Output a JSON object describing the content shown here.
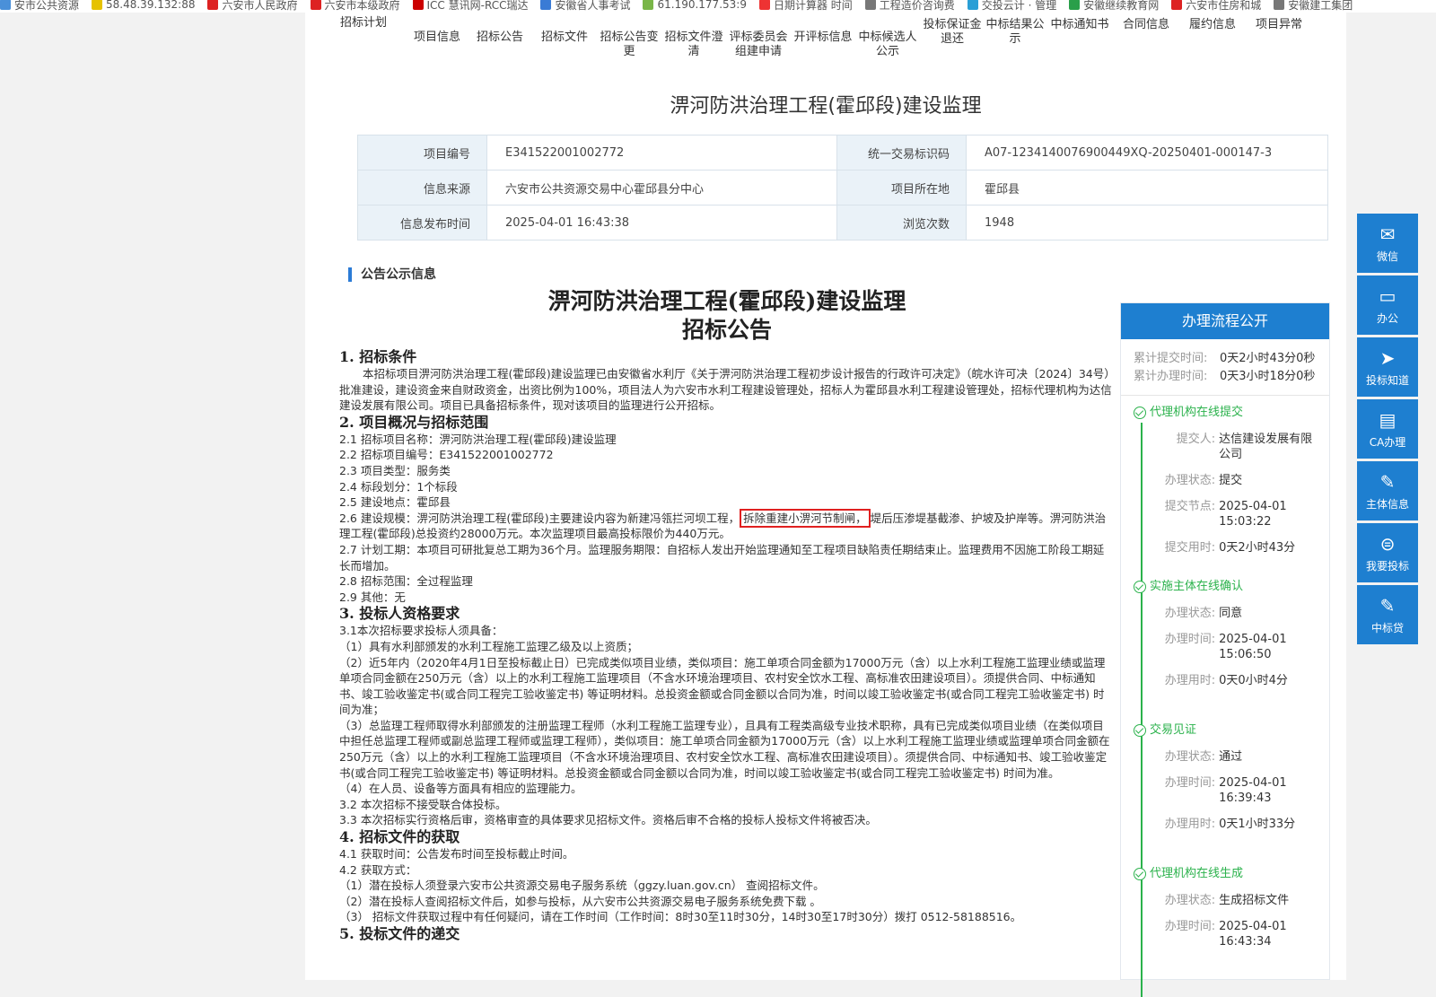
{
  "bookmarks": [
    {
      "label": "安市公共资源",
      "color": "#4a90d9"
    },
    {
      "label": "58.48.39.132:88",
      "color": "#e6c200"
    },
    {
      "label": "六安市人民政府",
      "color": "#d22"
    },
    {
      "label": "六安市本级政府",
      "color": "#d22"
    },
    {
      "label": "ICC 慧讯网-RCC瑞达",
      "color": "#c00"
    },
    {
      "label": "安徽省人事考试",
      "color": "#3a7bd5"
    },
    {
      "label": "61.190.177.53:9",
      "color": "#7ab648"
    },
    {
      "label": "日期计算器 时间",
      "color": "#e33"
    },
    {
      "label": "工程造价咨询费",
      "color": "#777"
    },
    {
      "label": "交投云计 · 管理",
      "color": "#2a9fd6"
    },
    {
      "label": "安徽继续教育网",
      "color": "#2a9f4a"
    },
    {
      "label": "六安市住房和城",
      "color": "#d22"
    },
    {
      "label": "安徽建工集团",
      "color": "#777"
    }
  ],
  "tabs_top": [
    "招标计划",
    "投标保证金退还",
    "中标结果公示",
    "中标通知书",
    "合同信息",
    "履约信息",
    "项目异常"
  ],
  "tabs": [
    "项目信息",
    "招标公告",
    "招标文件",
    "招标公告变更",
    "招标文件澄清",
    "评标委员会组建申请",
    "开评标信息",
    "中标候选人公示",
    "投标保证金退还",
    "中标结果公示",
    "中标通知书",
    "合同信息",
    "履约信息",
    "项目异常"
  ],
  "page_title": "淠河防洪治理工程(霍邱段)建设监理",
  "info": {
    "rows": [
      {
        "l1": "项目编号",
        "v1": "E341522001002772",
        "l2": "统一交易标识码",
        "v2": "A07-1234140076900449XQ-20250401-000147-3"
      },
      {
        "l1": "信息来源",
        "v1": "六安市公共资源交易中心霍邱县分中心",
        "l2": "项目所在地",
        "v2": "霍邱县"
      },
      {
        "l1": "信息发布时间",
        "v1": "2025-04-01 16:43:38",
        "l2": "浏览次数",
        "v2": "1948"
      }
    ]
  },
  "section_head": "公告公示信息",
  "doc": {
    "title1": "淠河防洪治理工程(霍邱段)建设监理",
    "title2": "招标公告",
    "h1": "1. 招标条件",
    "p1": "本招标项目淠河防洪治理工程(霍邱段)建设监理已由安徽省水利厅《关于淠河防洪治理工程初步设计报告的行政许可决定》（皖水许可决〔2024〕34号）批准建设，建设资金来自财政资金，出资比例为100%，项目法人为六安市水利工程建设管理处，招标人为霍邱县水利工程建设管理处，招标代理机构为达信建设发展有限公司。项目已具备招标条件，现对该项目的监理进行公开招标。",
    "h2": "2. 项目概况与招标范围",
    "s21": "2.1 招标项目名称：淠河防洪治理工程(霍邱段)建设监理",
    "s22": "2.2 招标项目编号：E341522001002772",
    "s23": "2.3 项目类型：服务类",
    "s24": "2.4 标段划分：1个标段",
    "s25": "2.5 建设地点：霍邱县",
    "s26a": "2.6 建设规模：淠河防洪治理工程(霍邱段)主要建设内容为新建冯瓴拦河坝工程，",
    "s26hl": "拆除重建小淠河节制闸，",
    "s26b": "堤后压渗堤基截渗、护坡及护岸等。淠河防洪治理工程(霍邱段)总投资约28000万元。本次监理项目最高投标限价为440万元。",
    "s27": "2.7 计划工期：本项目可研批复总工期为36个月。监理服务期限：自招标人发出开始监理通知至工程项目缺陷责任期结束止。监理费用不因施工阶段工期延长而增加。",
    "s28": "2.8 招标范围：全过程监理",
    "s29": "2.9 其他：无",
    "h3": "3. 投标人资格要求",
    "s31": "3.1本次招标要求投标人须具备：",
    "s31a": "（1）具有水利部颁发的水利工程施工监理乙级及以上资质；",
    "s31b": "（2）近5年内（2020年4月1日至投标截止日）已完成类似项目业绩，类似项目：施工单项合同金额为17000万元（含）以上水利工程施工监理业绩或监理单项合同金额在250万元（含）以上的水利工程施工监理项目（不含水环境治理项目、农村安全饮水工程、高标准农田建设项目）。须提供合同、中标通知书、竣工验收鉴定书(或合同工程完工验收鉴定书) 等证明材料。总投资金额或合同金额以合同为准，时间以竣工验收鉴定书(或合同工程完工验收鉴定书) 时间为准；",
    "s31c": "（3）总监理工程师取得水利部颁发的注册监理工程师（水利工程施工监理专业），且具有工程类高级专业技术职称，具有已完成类似项目业绩（在类似项目中担任总监理工程师或副总监理工程师或监理工程师），类似项目：施工单项合同金额为17000万元（含）以上水利工程施工监理业绩或监理单项合同金额在250万元（含）以上的水利工程施工监理项目（不含水环境治理项目、农村安全饮水工程、高标准农田建设项目）。须提供合同、中标通知书、竣工验收鉴定书(或合同工程完工验收鉴定书) 等证明材料。总投资金额或合同金额以合同为准，时间以竣工验收鉴定书(或合同工程完工验收鉴定书) 时间为准。",
    "s31d": "（4）在人员、设备等方面具有相应的监理能力。",
    "s32": "3.2 本次招标不接受联合体投标。",
    "s33": "3.3 本次招标实行资格后审，资格审查的具体要求见招标文件。资格后审不合格的投标人投标文件将被否决。",
    "h4": "4. 招标文件的获取",
    "s41": "4.1 获取时间：公告发布时间至投标截止时间。",
    "s42": "4.2 获取方式：",
    "s42a": "（1）潜在投标人须登录六安市公共资源交易电子服务系统（ggzy.luan.gov.cn） 查阅招标文件。",
    "s42b": "（2）潜在投标人查阅招标文件后，如参与投标，从六安市公共资源交易电子服务系统免费下载 。",
    "s42c": "（3） 招标文件获取过程中有任何疑问，请在工作时间（工作时间：8时30至11时30分，14时30至17时30分）拨打 0512-58188516。",
    "h5": "5. 投标文件的递交"
  },
  "process": {
    "title": "办理流程公开",
    "submit_label": "累计提交时间:",
    "submit_value": "0天2小时43分0秒",
    "handle_label": "累计办理时间:",
    "handle_value": "0天3小时18分0秒",
    "steps": [
      {
        "title": "代理机构在线提交",
        "items": [
          {
            "k": "提交人:",
            "v": "达信建设发展有限公司"
          },
          {
            "k": "办理状态:",
            "v": "提交"
          },
          {
            "k": "提交节点:",
            "v": "2025-04-01 15:03:22"
          },
          {
            "k": "提交用时:",
            "v": "0天2小时43分"
          }
        ]
      },
      {
        "title": "实施主体在线确认",
        "items": [
          {
            "k": "办理状态:",
            "v": "同意"
          },
          {
            "k": "办理时间:",
            "v": "2025-04-01 15:06:50"
          },
          {
            "k": "办理用时:",
            "v": "0天0小时4分"
          }
        ]
      },
      {
        "title": "交易见证",
        "items": [
          {
            "k": "办理状态:",
            "v": "通过"
          },
          {
            "k": "办理时间:",
            "v": "2025-04-01 16:39:43"
          },
          {
            "k": "办理用时:",
            "v": "0天1小时33分"
          }
        ]
      },
      {
        "title": "代理机构在线生成",
        "items": [
          {
            "k": "办理状态:",
            "v": "生成招标文件"
          },
          {
            "k": "办理时间:",
            "v": "2025-04-01 16:43:34"
          }
        ]
      }
    ]
  },
  "float_buttons": [
    {
      "label": "微信",
      "icon": "wechat-icon",
      "glyph": "✉"
    },
    {
      "label": "办公",
      "icon": "monitor-icon",
      "glyph": "▭"
    },
    {
      "label": "投标知道",
      "icon": "paper-plane-icon",
      "glyph": "➤"
    },
    {
      "label": "CA办理",
      "icon": "clipboard-icon",
      "glyph": "▤"
    },
    {
      "label": "主体信息",
      "icon": "edit-doc-icon",
      "glyph": "✎"
    },
    {
      "label": "我要投标",
      "icon": "circle-list-icon",
      "glyph": "⊜"
    },
    {
      "label": "中标贷",
      "icon": "edit-doc-icon",
      "glyph": "✎"
    }
  ],
  "colors": {
    "accent": "#1e7fd0",
    "success": "#2bb24c",
    "highlight": "#e02020"
  }
}
